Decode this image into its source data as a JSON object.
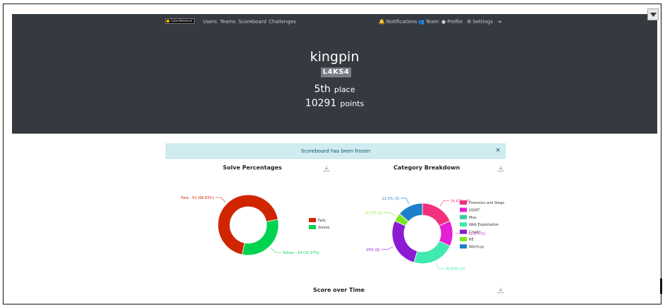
{
  "nav": {
    "logo_text": "CyberWeekend",
    "links": [
      "Users",
      "Teams",
      "Scoreboard",
      "Challenges"
    ],
    "right": [
      "Notifications",
      "Team",
      "Profile",
      "Settings"
    ]
  },
  "profile": {
    "name": "kingpin",
    "team": "L4KS4",
    "place_value": "5th",
    "place_label": "place",
    "points_value": "10291",
    "points_label": "points"
  },
  "alert": {
    "message": "Scoreboard has been frozen",
    "close": "×"
  },
  "charts": {
    "solve_title": "Solve Percentages",
    "category_title": "Category Breakdown",
    "score_title": "Score over Time"
  },
  "chart_data": [
    {
      "type": "pie",
      "title": "Solve Percentages",
      "labels": [
        "Fails",
        "Solves"
      ],
      "values": [
        53,
        24
      ],
      "data_labels": [
        "Fails - 53 (68.83%)",
        "Solves - 24 (31.17%)"
      ],
      "colors": [
        "#cf2600",
        "#00d34f"
      ],
      "legend": "right"
    },
    {
      "type": "pie",
      "title": "Category Breakdown",
      "labels": [
        "Forensics and Stego",
        "OSINT",
        "Misc",
        "Web Exploitation",
        "Crypto",
        "RE",
        "Warmup"
      ],
      "values": [
        4,
        3,
        0,
        5,
        6,
        1,
        3
      ],
      "data_labels": [
        "16.67% (4)",
        "12.5% (3)",
        "",
        "20.83% (5)",
        "25% (6)",
        "4.17% (1)",
        "12.5% (3)"
      ],
      "colors": [
        "#f2307b",
        "#e51fd6",
        "#3cc9a0",
        "#41e8b0",
        "#8c1bd4",
        "#7ee81e",
        "#1d7ec9"
      ],
      "legend": "right"
    }
  ],
  "colors": {
    "hero_bg": "#343a40",
    "alert_bg": "#d1ecf1"
  },
  "icons": [
    "bell-icon",
    "users-icon",
    "user-circle-icon",
    "gears-icon",
    "sign-out-icon",
    "download-icon"
  ]
}
